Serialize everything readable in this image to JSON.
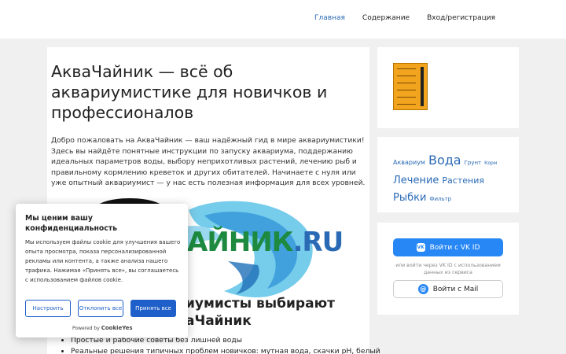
{
  "nav": {
    "items": [
      {
        "label": "Главная",
        "active": true
      },
      {
        "label": "Содержание",
        "active": false
      },
      {
        "label": "Вход/регистрация",
        "active": false
      }
    ]
  },
  "main": {
    "title": "АкваЧайник — всё об аквариумистике для новичков и профессионалов",
    "intro": "Добро пожаловать на АкваЧайник — ваш надёжный гид в мире аквариумистики! Здесь вы найдёте понятные инструкции по запуску аквариума, поддержанию идеальных параметров воды, выбору неприхотливых растений, лечению рыб и правильному кормлению креветок и других обитателей. Начинаете с нуля или уже опытный аквариумист — у нас есть полезная информация для всех уровней.",
    "logo_left": "АЙНИК",
    "logo_right": ".RU",
    "h2": "иумисты выбирают\nаЧайник",
    "bullets": [
      "Простые и рабочие советы без лишней воды",
      "Реальные решения типичных проблем новичков: мутная вода, скачки pH, белый"
    ]
  },
  "sidebar": {
    "tags": [
      {
        "label": "Аквариум",
        "size": 8
      },
      {
        "label": "Вода",
        "size": 16
      },
      {
        "label": "Грунт",
        "size": 7
      },
      {
        "label": "Корм",
        "size": 6
      },
      {
        "label": "Лечение",
        "size": 13
      },
      {
        "label": "Растения",
        "size": 11
      },
      {
        "label": "Рыбки",
        "size": 13
      },
      {
        "label": "Фильтр",
        "size": 7
      }
    ],
    "vk_button": "Войти с VK ID",
    "vk_note": "или войти через VK ID с использованием данных из сервиса",
    "mail_button": "Войти с Mail"
  },
  "cookie": {
    "title": "Мы ценим вашу конфиденциальность",
    "body": "Мы используем файлы cookie для улучшения вашего опыта просмотра, показа персонализированной рекламы или контента, а также анализа нашего трафика. Нажимая «Принять все», вы соглашаетесь с использованием файлов cookie.",
    "customize": "Настроить",
    "reject": "Отклонить все",
    "accept": "Принять все",
    "powered_prefix": "Powered by",
    "powered_brand": "CookieYes"
  },
  "colors": {
    "accent": "#2a6ab5",
    "logo_green": "#1d8a3f",
    "vk_blue": "#2787f5",
    "cookie_blue": "#1f5fc9"
  }
}
